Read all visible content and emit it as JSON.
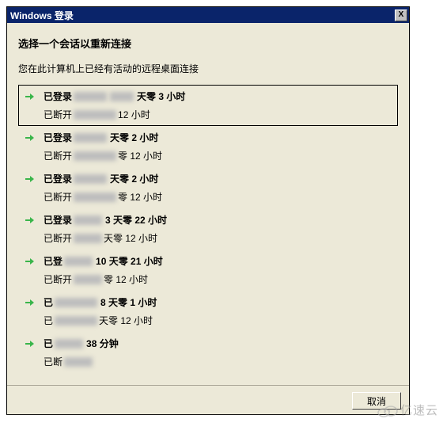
{
  "titlebar": {
    "title": "Windows 登录",
    "close": "X"
  },
  "heading": "选择一个会话以重新连接",
  "subtext": "您在此计算机上已经有活动的远程桌面连接",
  "sessions": [
    {
      "login_prefix": "已登录",
      "duration": "天零 3 小时",
      "disc_prefix": "已断开",
      "idle": "12 小时"
    },
    {
      "login_prefix": "已登录",
      "duration": "天零 2 小时",
      "disc_prefix": "已断开",
      "idle": "零 12 小时"
    },
    {
      "login_prefix": "已登录",
      "duration": "天零 2 小时",
      "disc_prefix": "已断开",
      "idle": "零 12 小时"
    },
    {
      "login_prefix": "已登录",
      "duration": "3 天零 22 小时",
      "disc_prefix": "已断开",
      "idle": "天零 12 小时"
    },
    {
      "login_prefix": "已登",
      "duration": "10 天零 21 小时",
      "disc_prefix": "已断开",
      "idle": "零 12 小时"
    },
    {
      "login_prefix": "已",
      "duration": "8 天零 1 小时",
      "disc_prefix": "已",
      "idle": "天零 12 小时"
    },
    {
      "login_prefix": "已",
      "duration": "38 分钟",
      "disc_prefix": "已断",
      "idle": ""
    }
  ],
  "footer": {
    "cancel": "取消"
  },
  "watermark": "亿速云"
}
